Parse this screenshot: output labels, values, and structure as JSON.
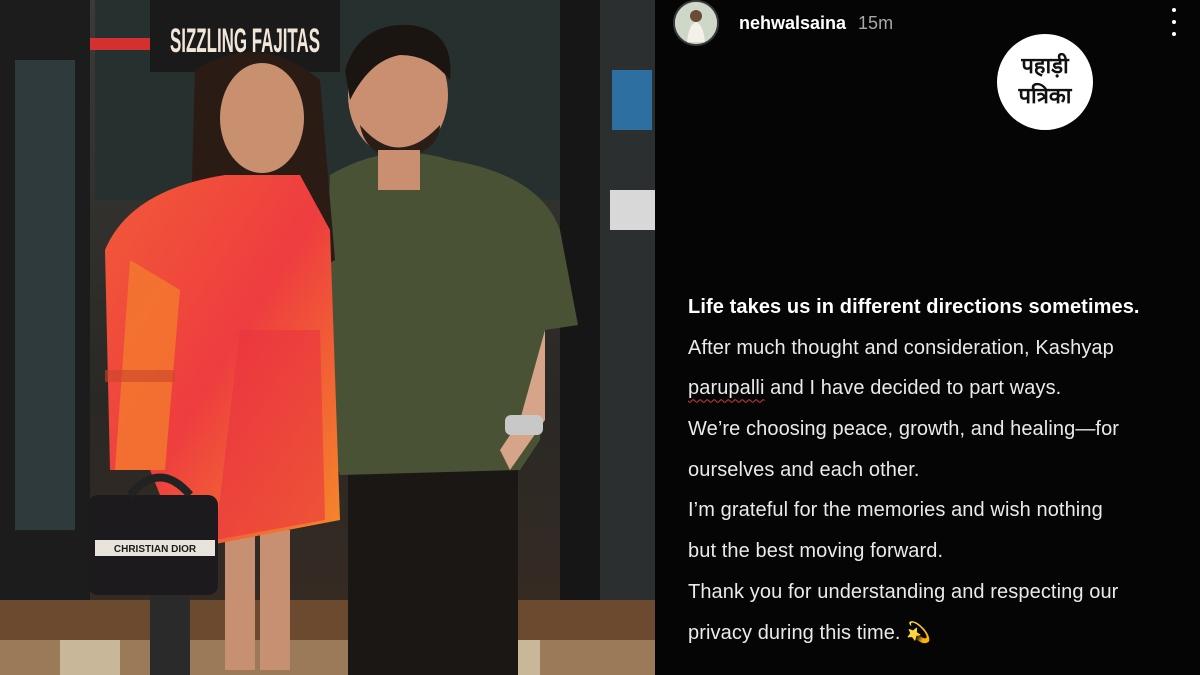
{
  "story": {
    "username": "nehwalsaina",
    "time": "15m",
    "more_icon": "more-vertical-icon",
    "caption": {
      "heading": "Life takes us in different directions sometimes.",
      "l2": "After much thought and consideration, Kashyap",
      "l3a": "parupalli",
      "l3b": " and I have decided to part ways.",
      "l4": "We’re choosing peace, growth, and healing—for",
      "l5": "ourselves and each other.",
      "l6": "I’m grateful for the memories and wish nothing",
      "l7": "but the best moving forward.",
      "l8": "Thank you for understanding and respecting our",
      "l9": "privacy during this time.",
      "emoji": "💫"
    }
  },
  "watermark": {
    "line1": "पहाड़ी",
    "line2": "पत्रिका"
  },
  "photo": {
    "sign_text": "SIZZLING FAJITAS",
    "bag_text": "CHRISTIAN DIOR"
  },
  "colors": {
    "background": "#050505",
    "text": "#eaeaea",
    "dress": "#f24a2a",
    "shirt": "#4a5236"
  }
}
